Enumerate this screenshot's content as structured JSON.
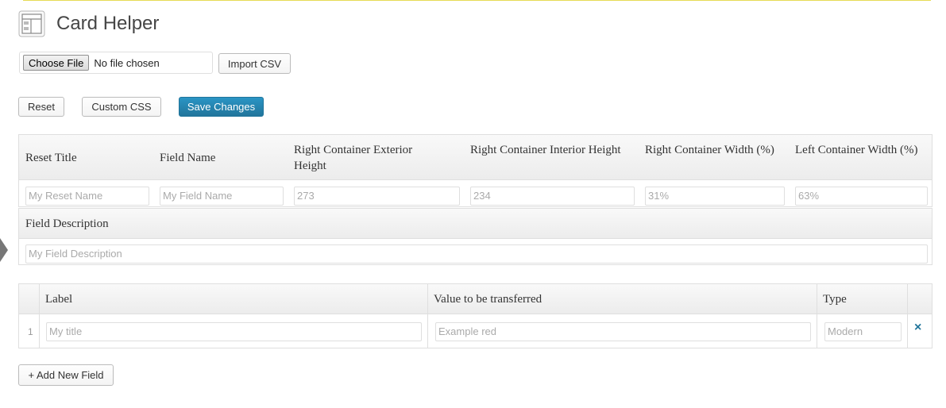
{
  "page": {
    "title": "Card Helper",
    "icon": "settings-page-icon"
  },
  "import": {
    "choose_file_label": "Choose File",
    "file_status": "No file chosen",
    "import_label": "Import CSV"
  },
  "actions": {
    "reset_label": "Reset",
    "custom_css_label": "Custom CSS",
    "save_label": "Save Changes"
  },
  "settings": {
    "headers": [
      "Reset Title",
      "Field Name",
      "Right Container Exterior Height",
      "Right Container Interior Height",
      "Right Container Width (%)",
      "Left Container Width (%)"
    ],
    "placeholders": [
      "My Reset Name",
      "My Field Name",
      "273",
      "234",
      "31%",
      "63%"
    ],
    "description_header": "Field Description",
    "description_placeholder": "My Field Description"
  },
  "fields_table": {
    "headers": [
      "Label",
      "Value to be transferred",
      "Type"
    ],
    "rows": [
      {
        "num": "1",
        "label_placeholder": "My title",
        "value_placeholder": "Example red",
        "type_placeholder": "Modern"
      }
    ],
    "remove_icon": "close-icon",
    "remove_glyph": "×"
  },
  "add_field_label": "+ Add New Field",
  "colors": {
    "primary": "#21759b",
    "notice_line": "#e6db55",
    "border": "#dfdfdf"
  }
}
